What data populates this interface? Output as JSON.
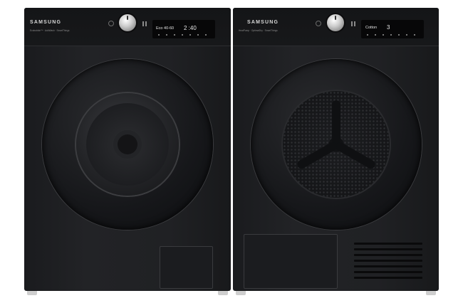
{
  "washer": {
    "brand": "SAMSUNG",
    "features": "Ecobubble™ · AddWash · SmartThings",
    "display": {
      "program": "Eco 40-60",
      "time": "2 :40"
    }
  },
  "dryer": {
    "brand": "SAMSUNG",
    "features": "HeatPump · OptimalDry · SmartThings",
    "display": {
      "program": "Cotton",
      "value": "3"
    }
  },
  "colors": {
    "body": "#1f2023",
    "panel": "#151618",
    "knob": "#c8c8c8"
  }
}
